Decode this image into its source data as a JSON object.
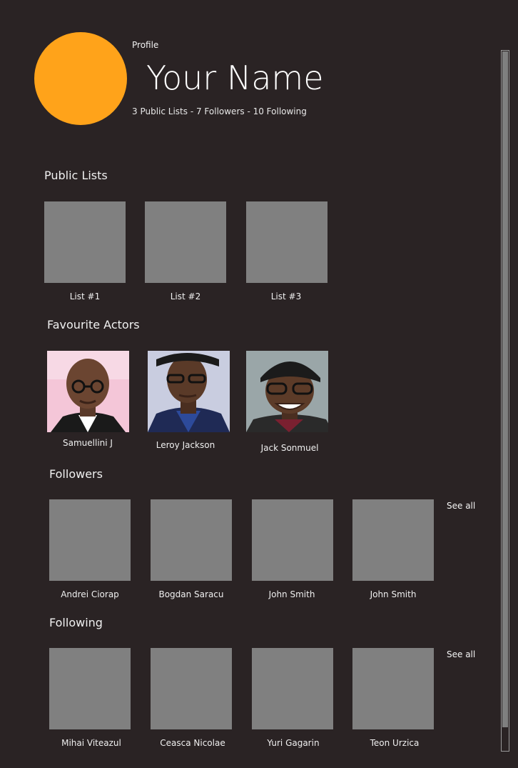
{
  "profile": {
    "label": "Profile",
    "name": "Your Name",
    "stats": "3 Public Lists - 7 Followers - 10 Following",
    "avatar_color": "#FFA31A"
  },
  "public_lists": {
    "title": "Public Lists",
    "items": [
      {
        "label": "List #1"
      },
      {
        "label": "List #2"
      },
      {
        "label": "List #3"
      }
    ]
  },
  "favourite_actors": {
    "title": "Favourite Actors",
    "items": [
      {
        "label": "Samuellini J"
      },
      {
        "label": "Leroy Jackson"
      },
      {
        "label": "Jack Sonmuel"
      }
    ]
  },
  "followers": {
    "title": "Followers",
    "see_all": "See all",
    "items": [
      {
        "label": "Andrei Ciorap"
      },
      {
        "label": "Bogdan Saracu"
      },
      {
        "label": "John Smith"
      },
      {
        "label": "John Smith"
      }
    ]
  },
  "following": {
    "title": "Following",
    "see_all": "See all",
    "items": [
      {
        "label": "Mihai Viteazul"
      },
      {
        "label": "Ceasca Nicolae"
      },
      {
        "label": "Yuri Gagarin"
      },
      {
        "label": "Teon Urzica"
      }
    ]
  },
  "colors": {
    "background": "#2A2324",
    "placeholder_tile": "#808080",
    "accent": "#FFA31A"
  }
}
